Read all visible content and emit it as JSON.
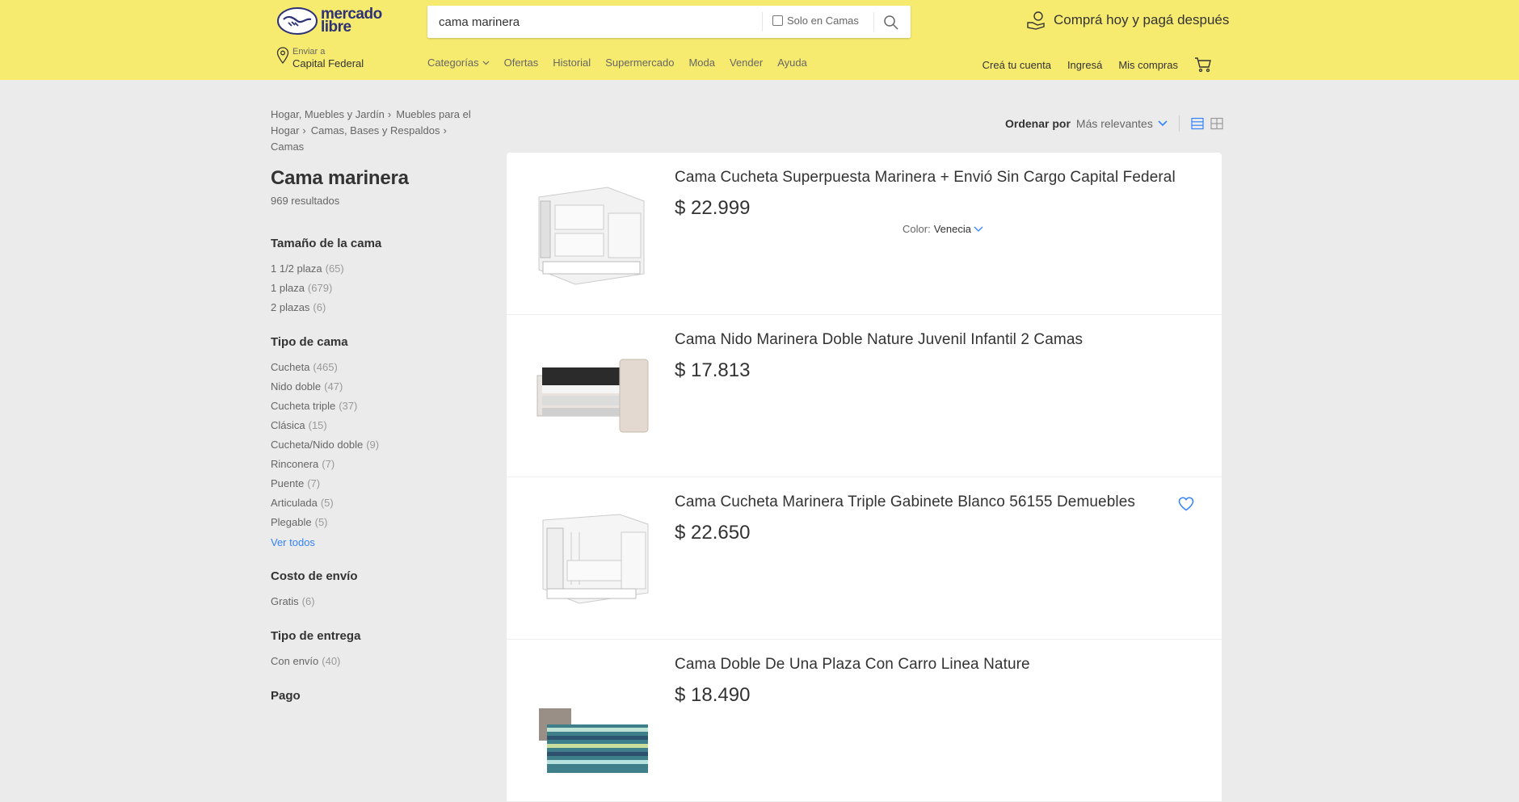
{
  "header": {
    "brand_line1": "mercado",
    "brand_line2": "libre",
    "search_value": "cama marinera",
    "solo_label": "Solo en Camas",
    "promo": "Comprá hoy y pagá después",
    "location_small": "Enviar a",
    "location_big": "Capital Federal",
    "nav": [
      "Categorías",
      "Ofertas",
      "Historial",
      "Supermercado",
      "Moda",
      "Vender",
      "Ayuda"
    ],
    "user_nav": [
      "Creá tu cuenta",
      "Ingresá",
      "Mis compras"
    ]
  },
  "breadcrumb": [
    "Hogar, Muebles y Jardín",
    "Muebles para el Hogar",
    "Camas, Bases y Respaldos",
    "Camas"
  ],
  "results": {
    "title": "Cama marinera",
    "count": "969 resultados"
  },
  "filters": [
    {
      "title": "Tamaño de la cama",
      "items": [
        {
          "label": "1 1/2 plaza",
          "count": "(65)"
        },
        {
          "label": "1 plaza",
          "count": "(679)"
        },
        {
          "label": "2 plazas",
          "count": "(6)"
        }
      ]
    },
    {
      "title": "Tipo de cama",
      "items": [
        {
          "label": "Cucheta",
          "count": "(465)"
        },
        {
          "label": "Nido doble",
          "count": "(47)"
        },
        {
          "label": "Cucheta triple",
          "count": "(37)"
        },
        {
          "label": "Clásica",
          "count": "(15)"
        },
        {
          "label": "Cucheta/Nido doble",
          "count": "(9)"
        },
        {
          "label": "Rinconera",
          "count": "(7)"
        },
        {
          "label": "Puente",
          "count": "(7)"
        },
        {
          "label": "Articulada",
          "count": "(5)"
        },
        {
          "label": "Plegable",
          "count": "(5)"
        }
      ],
      "ver_todos": "Ver todos"
    },
    {
      "title": "Costo de envío",
      "items": [
        {
          "label": "Gratis",
          "count": "(6)"
        }
      ]
    },
    {
      "title": "Tipo de entrega",
      "items": [
        {
          "label": "Con envío",
          "count": "(40)"
        }
      ]
    },
    {
      "title": "Pago",
      "items": []
    }
  ],
  "sort": {
    "label": "Ordenar por",
    "value": "Más relevantes"
  },
  "items": [
    {
      "title": "Cama Cucheta Superpuesta Marinera + Envió Sin Cargo Capital Federal",
      "price": "$ 22.999",
      "color_label": "Color:",
      "color_value": "Venecia"
    },
    {
      "title": "Cama Nido Marinera Doble Nature Juvenil Infantil 2 Camas",
      "price": "$ 17.813"
    },
    {
      "title": "Cama Cucheta Marinera Triple Gabinete Blanco 56155 Demuebles",
      "price": "$ 22.650"
    },
    {
      "title": "Cama Doble De Una Plaza Con Carro Linea Nature",
      "price": "$ 18.490"
    }
  ],
  "colors": {
    "header_bg": "#f7eb6f",
    "accent": "#3483fa",
    "brand": "#2d3277"
  }
}
